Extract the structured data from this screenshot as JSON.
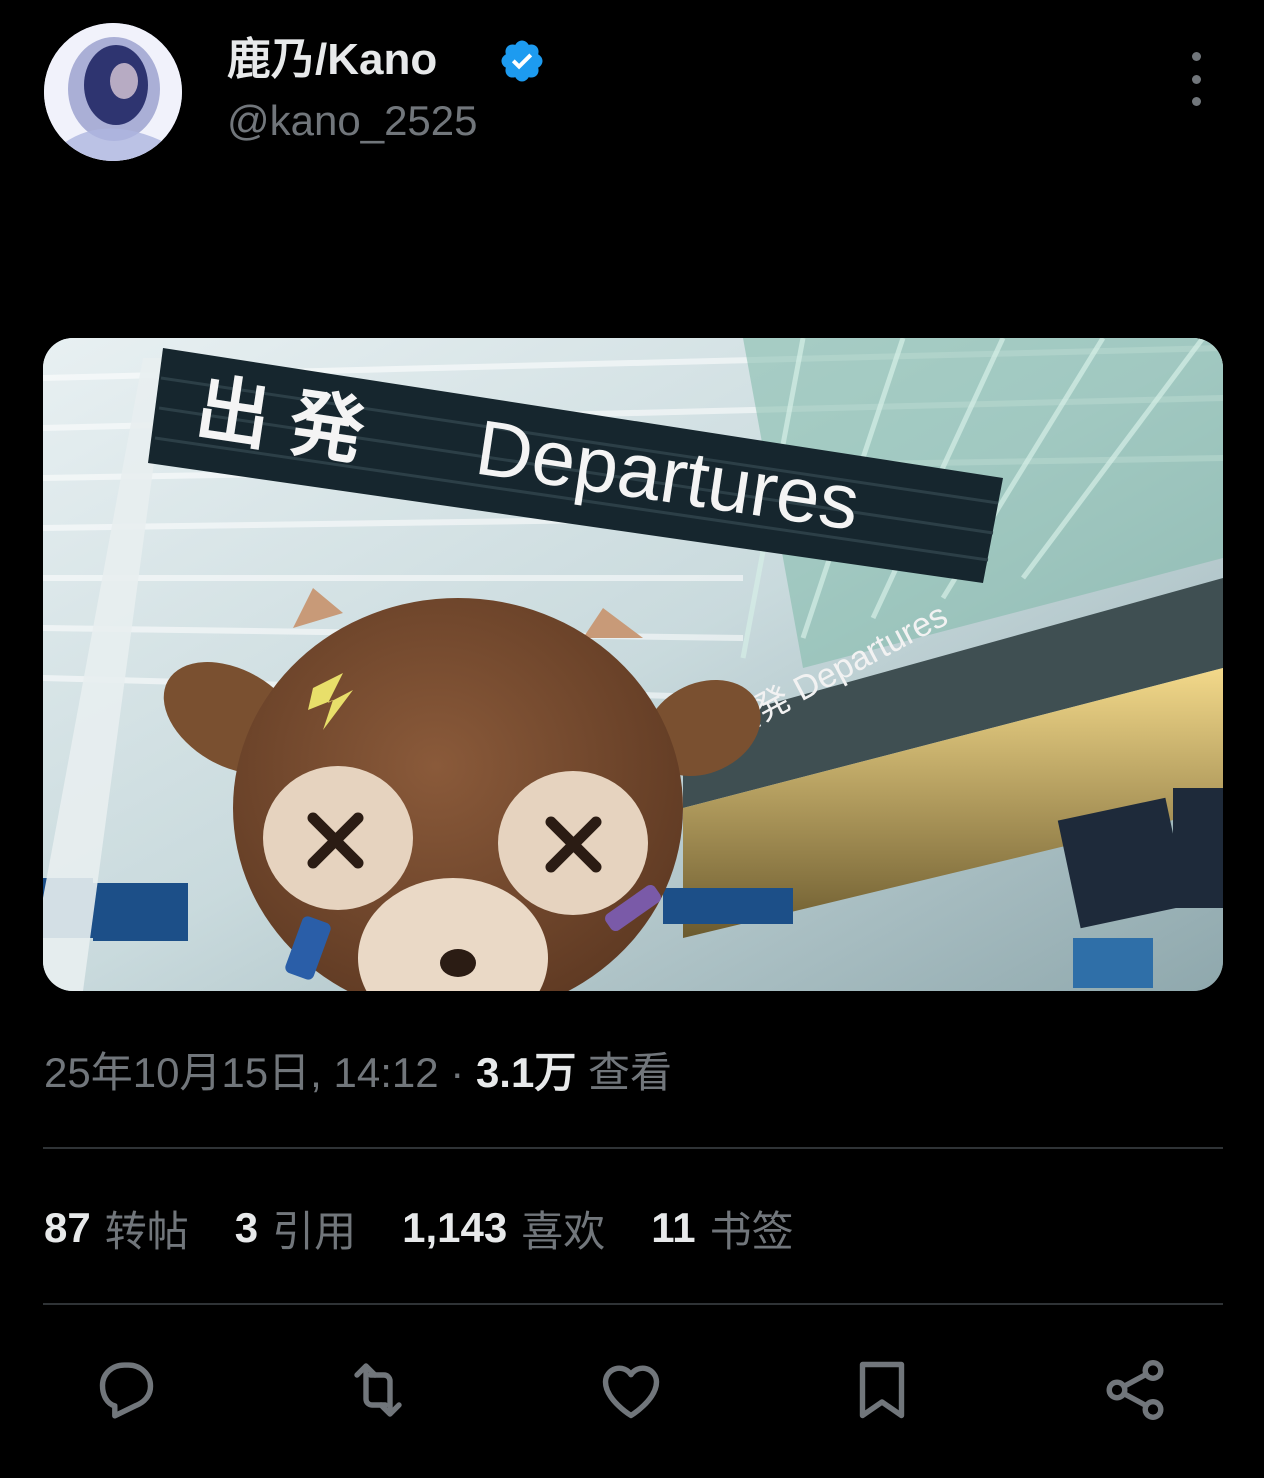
{
  "author": {
    "display_name": "鹿乃/Kano",
    "handle": "@kano_2525",
    "verified": true,
    "verified_color": "#1d9bf0"
  },
  "media": {
    "sign_text_jp": "出 発",
    "sign_text_en": "Departures"
  },
  "meta": {
    "timestamp": "25年10月15日, 14:12",
    "separator": "·",
    "views_count": "3.1万",
    "views_label": "查看"
  },
  "stats": [
    {
      "count": "87",
      "label": "转帖"
    },
    {
      "count": "3",
      "label": "引用"
    },
    {
      "count": "1,143",
      "label": "喜欢"
    },
    {
      "count": "11",
      "label": "书签"
    }
  ],
  "actions": {
    "reply_icon": "reply-icon",
    "repost_icon": "repost-icon",
    "like_icon": "heart-icon",
    "bookmark_icon": "bookmark-icon",
    "share_icon": "share-icon"
  },
  "colors": {
    "background": "#000000",
    "primary_text": "#e7e9ea",
    "secondary_text": "#71767b",
    "divider": "#2f3336"
  }
}
